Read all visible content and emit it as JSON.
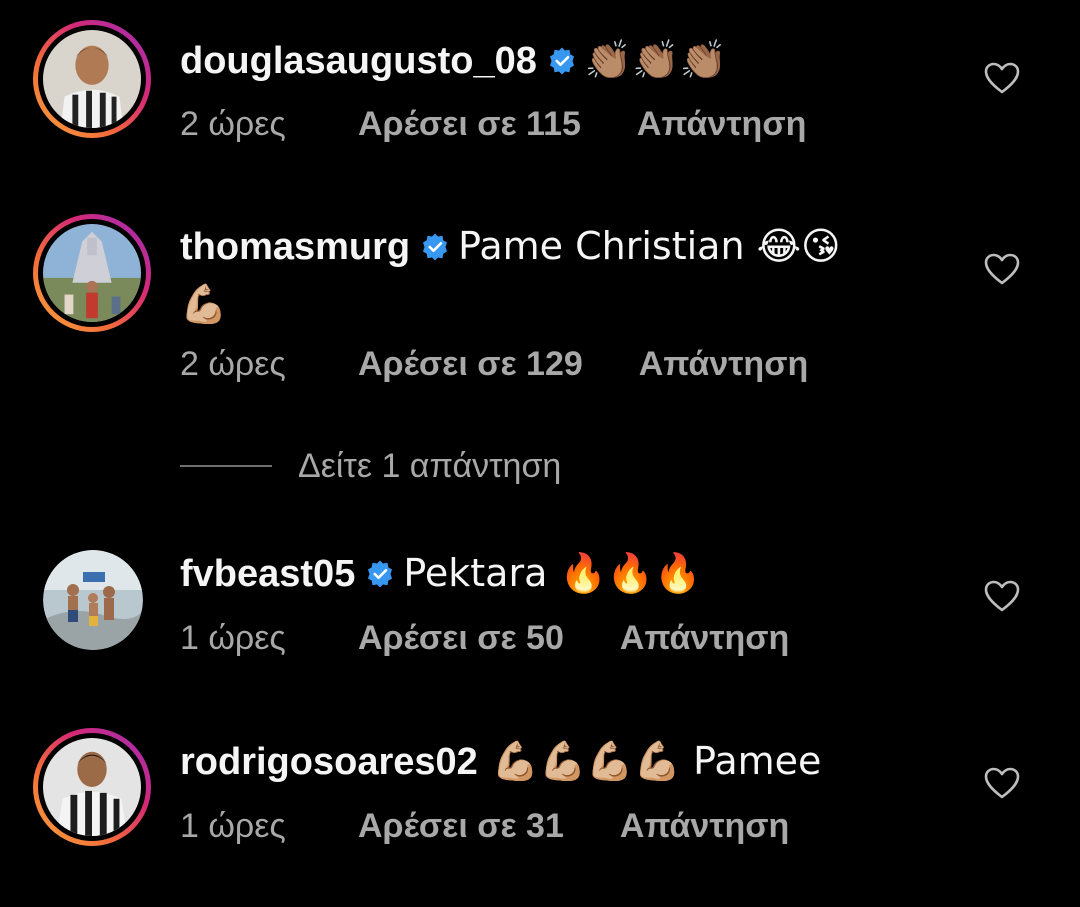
{
  "colors": {
    "background": "#000000",
    "text_primary": "#f5f5f5",
    "text_secondary": "#a8a8a8",
    "verified_blue": "#3897f0"
  },
  "comments": [
    {
      "username": "douglasaugusto_08",
      "verified": true,
      "text": "👏🏽👏🏽👏🏽",
      "time": "2 ώρες",
      "likes": "Αρέσει σε 115",
      "reply": "Απάντηση",
      "story_ring": true,
      "icons": [
        "avatar",
        "verified-badge-icon",
        "heart-outline-icon"
      ]
    },
    {
      "username": "thomasmurg",
      "verified": true,
      "text": "Pame Christian 😂😘",
      "text_cont": "💪🏼",
      "time": "2 ώρες",
      "likes": "Αρέσει σε 129",
      "reply": "Απάντηση",
      "story_ring": true
    },
    {
      "username": "fvbeast05",
      "verified": true,
      "text": "Pektara 🔥🔥🔥",
      "time": "1 ώρες",
      "likes": "Αρέσει σε 50",
      "reply": "Απάντηση",
      "story_ring": false
    },
    {
      "username": "rodrigosoares02",
      "verified": false,
      "text": "💪🏼💪🏼💪🏼💪🏼 Pamee",
      "time": "1 ώρες",
      "likes": "Αρέσει σε 31",
      "reply": "Απάντηση",
      "story_ring": true
    }
  ],
  "view_replies": "Δείτε 1 απάντηση"
}
